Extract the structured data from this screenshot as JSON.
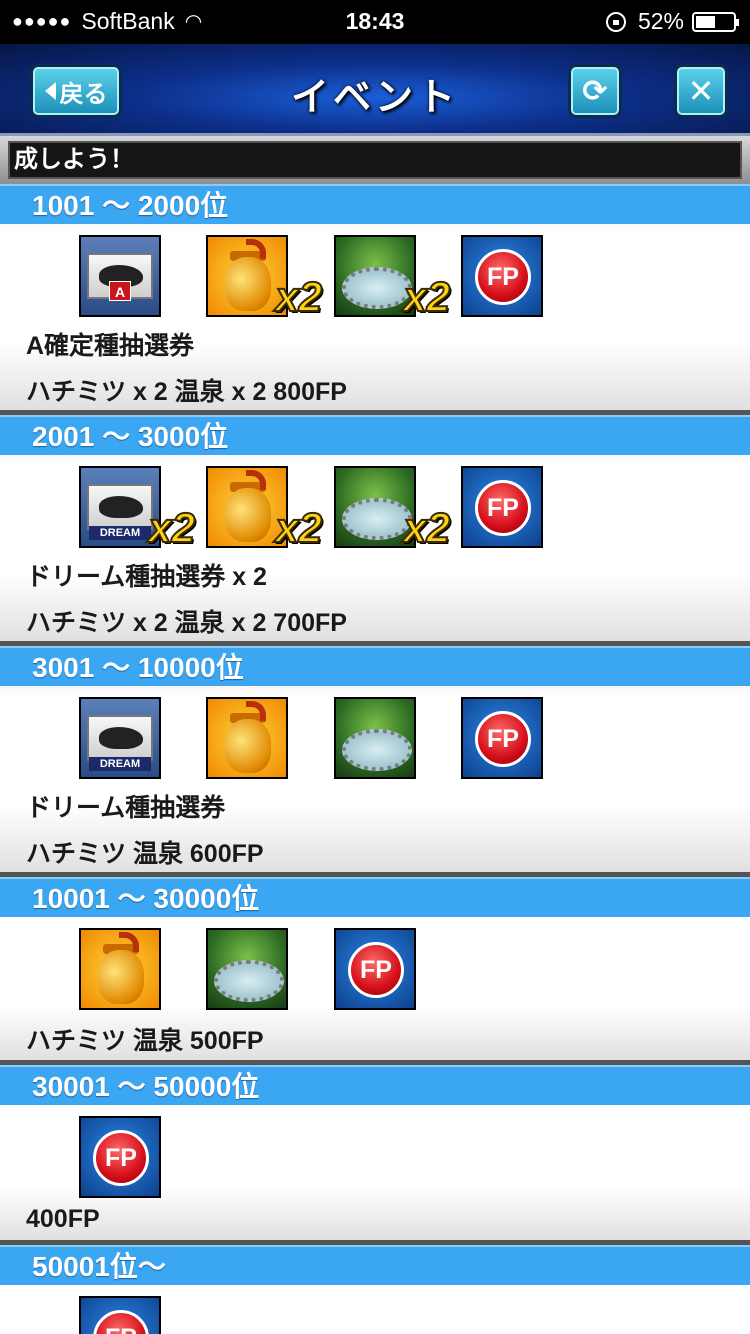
{
  "status_bar": {
    "signal": "●●●●●",
    "carrier": "SoftBank",
    "time": "18:43",
    "battery_text": "52%",
    "battery_level": 0.52
  },
  "header": {
    "back_label": "戻る",
    "title": "イベント",
    "reload_icon": "reload-icon",
    "close_label": "✕"
  },
  "ticker": {
    "text": "成しよう！"
  },
  "multiplier": "x2",
  "icon_labels": {
    "fp": "FP",
    "dream": "DREAM",
    "a_badge": "A"
  },
  "ranks": [
    {
      "range": "1001 〜 2000位",
      "desc_lines": [
        "A確定種抽選券",
        "ハチミツ x 2 温泉 x 2 800FP"
      ]
    },
    {
      "range": "2001 〜 3000位",
      "desc_lines": [
        "ドリーム種抽選券 x 2",
        "ハチミツ x 2 温泉 x 2 700FP"
      ]
    },
    {
      "range": "3001 〜 10000位",
      "desc_lines": [
        "ドリーム種抽選券",
        "ハチミツ 温泉 600FP"
      ]
    },
    {
      "range": "10001 〜 30000位",
      "desc_lines": [
        "ハチミツ 温泉 500FP"
      ]
    },
    {
      "range": "30001 〜 50000位",
      "desc_lines": [
        "400FP"
      ]
    },
    {
      "range": "50001位〜",
      "desc_lines": []
    }
  ],
  "colors": {
    "rank_header": "#3ba7f2",
    "button": "#1a8db8"
  }
}
